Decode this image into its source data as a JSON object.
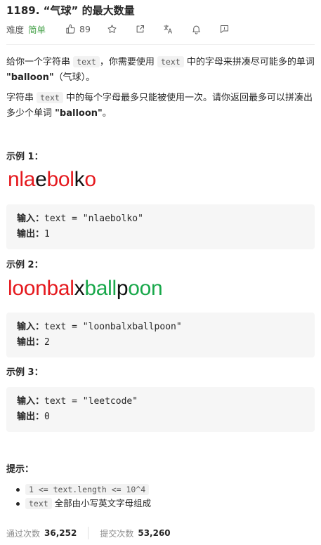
{
  "header": {
    "title": "1189. “气球” 的最大数量",
    "difficulty_label": "难度",
    "difficulty": "简单",
    "likes": "89"
  },
  "description": {
    "p1_pre": "给你一个字符串 ",
    "p1_code1": "text",
    "p1_mid": "，你需要使用 ",
    "p1_code2": "text",
    "p1_post": " 中的字母来拼凑尽可能多的单词 ",
    "p1_word": "\"balloon\"",
    "p1_end": "（气球）。",
    "p2_pre": "字符串 ",
    "p2_code": "text",
    "p2_post": " 中的每个字母最多只能被使用一次。请你返回最多可以拼凑出多少个单词 ",
    "p2_word": "\"balloon\"",
    "p2_end": "。"
  },
  "examples": [
    {
      "title": "示例 1：",
      "image_segments": [
        {
          "text": "nla",
          "color": "red"
        },
        {
          "text": "e",
          "color": "black"
        },
        {
          "text": "bol",
          "color": "red"
        },
        {
          "text": "k",
          "color": "black"
        },
        {
          "text": "o",
          "color": "red"
        }
      ],
      "input_label": "输入：",
      "input": "text = \"nlaebolko\"",
      "output_label": "输出：",
      "output": "1"
    },
    {
      "title": "示例 2：",
      "image_segments": [
        {
          "text": "loonbal",
          "color": "red"
        },
        {
          "text": "x",
          "color": "black"
        },
        {
          "text": "ball",
          "color": "green"
        },
        {
          "text": "p",
          "color": "black"
        },
        {
          "text": "oon",
          "color": "green"
        }
      ],
      "input_label": "输入：",
      "input": "text = \"loonbalxballpoon\"",
      "output_label": "输出：",
      "output": "2"
    },
    {
      "title": "示例 3：",
      "input_label": "输入：",
      "input": "text = \"leetcode\"",
      "output_label": "输出：",
      "output": "0"
    }
  ],
  "hints": {
    "title": "提示：",
    "items": [
      {
        "code": "1 <= text.length <= 10^4",
        "text": ""
      },
      {
        "code": "text",
        "text": " 全部由小写英文字母组成"
      }
    ]
  },
  "stats": {
    "accepted_label": "通过次数",
    "accepted": "36,252",
    "submitted_label": "提交次数",
    "submitted": "53,260"
  },
  "icons": [
    "thumbs-up-icon",
    "star-icon",
    "share-icon",
    "translate-icon",
    "bell-icon",
    "comment-icon"
  ],
  "colors": {
    "difficulty": "#43a047",
    "red": "#e5191e",
    "green": "#19a84b",
    "black": "#111111"
  }
}
